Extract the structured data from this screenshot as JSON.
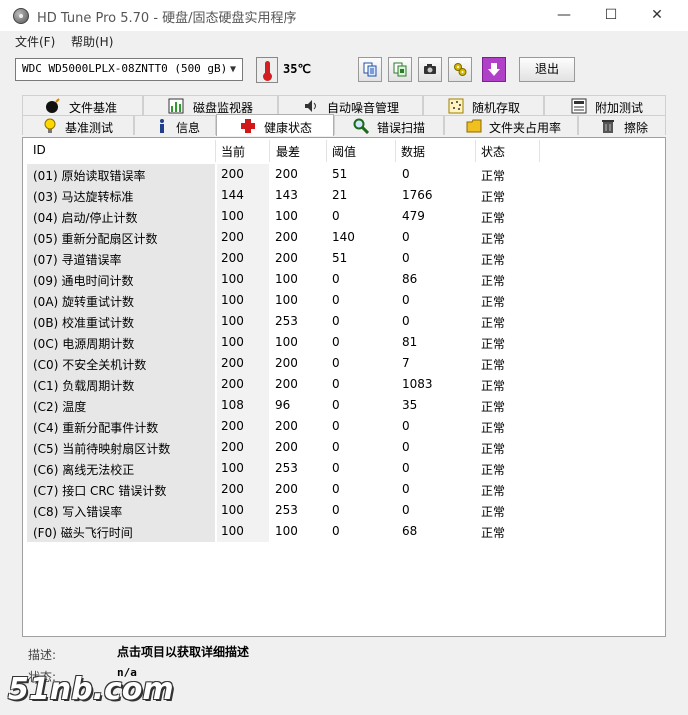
{
  "window": {
    "title": "HD Tune Pro 5.70 - 硬盘/固态硬盘实用程序",
    "minimize": "—",
    "maximize": "☐",
    "close": "✕"
  },
  "menu": {
    "file": "文件(F)",
    "help": "帮助(H)"
  },
  "toolbar": {
    "drive": "WDC WD5000LPLX-08ZNTT0 (500 gB)",
    "temperature": "35℃",
    "exit_label": "退出"
  },
  "tabs": {
    "row1": [
      "文件基准",
      "磁盘监视器",
      "自动噪音管理",
      "随机存取",
      "附加测试"
    ],
    "row2": [
      "基准测试",
      "信息",
      "健康状态",
      "错误扫描",
      "文件夹占用率",
      "擦除"
    ],
    "active": "健康状态"
  },
  "table": {
    "headers": [
      "ID",
      "当前",
      "最差",
      "阈值",
      "数据",
      "状态"
    ],
    "rows": [
      [
        "(01) 原始读取错误率",
        "200",
        "200",
        "51",
        "0",
        "正常"
      ],
      [
        "(03) 马达旋转标准",
        "144",
        "143",
        "21",
        "1766",
        "正常"
      ],
      [
        "(04) 启动/停止计数",
        "100",
        "100",
        "0",
        "479",
        "正常"
      ],
      [
        "(05) 重新分配扇区计数",
        "200",
        "200",
        "140",
        "0",
        "正常"
      ],
      [
        "(07) 寻道错误率",
        "200",
        "200",
        "51",
        "0",
        "正常"
      ],
      [
        "(09) 通电时间计数",
        "100",
        "100",
        "0",
        "86",
        "正常"
      ],
      [
        "(0A) 旋转重试计数",
        "100",
        "100",
        "0",
        "0",
        "正常"
      ],
      [
        "(0B) 校准重试计数",
        "100",
        "253",
        "0",
        "0",
        "正常"
      ],
      [
        "(0C) 电源周期计数",
        "100",
        "100",
        "0",
        "81",
        "正常"
      ],
      [
        "(C0) 不安全关机计数",
        "200",
        "200",
        "0",
        "7",
        "正常"
      ],
      [
        "(C1) 负载周期计数",
        "200",
        "200",
        "0",
        "1083",
        "正常"
      ],
      [
        "(C2) 温度",
        "108",
        "96",
        "0",
        "35",
        "正常"
      ],
      [
        "(C4) 重新分配事件计数",
        "200",
        "200",
        "0",
        "0",
        "正常"
      ],
      [
        "(C5) 当前待映射扇区计数",
        "200",
        "200",
        "0",
        "0",
        "正常"
      ],
      [
        "(C6) 离线无法校正",
        "100",
        "253",
        "0",
        "0",
        "正常"
      ],
      [
        "(C7) 接口 CRC 错误计数",
        "200",
        "200",
        "0",
        "0",
        "正常"
      ],
      [
        "(C8) 写入错误率",
        "100",
        "253",
        "0",
        "0",
        "正常"
      ],
      [
        "(F0) 磁头飞行时间",
        "100",
        "100",
        "0",
        "68",
        "正常"
      ]
    ]
  },
  "footer": {
    "desc_label": "描述:",
    "desc_text": "点击项目以获取详细描述",
    "state_label": "状态:",
    "state_text": "n/a"
  },
  "watermark": "51nb.com"
}
